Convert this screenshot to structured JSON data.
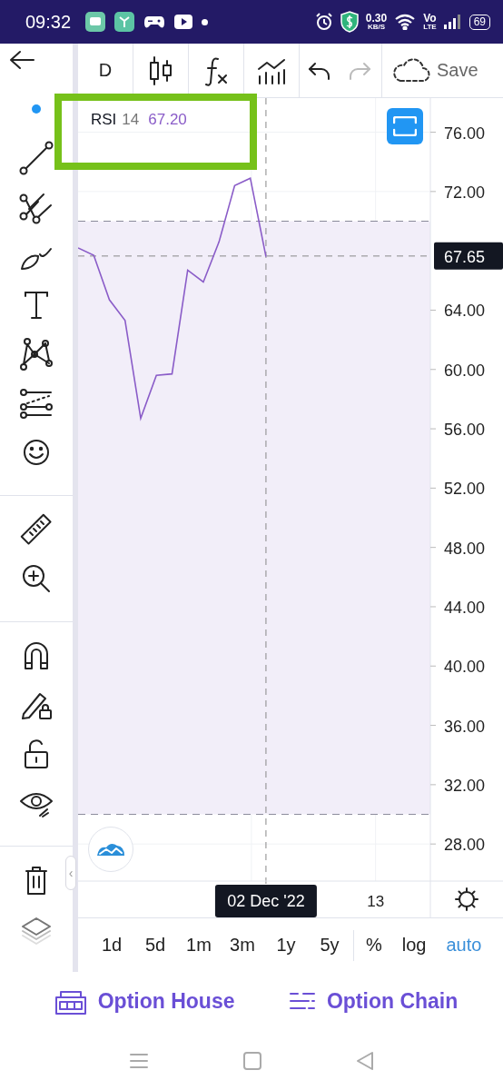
{
  "status_bar": {
    "time": "09:32",
    "notifications": [
      {
        "kind": "chat"
      },
      {
        "kind": "app"
      },
      {
        "kind": "gamepad"
      },
      {
        "kind": "video"
      },
      {
        "kind": "dot"
      }
    ],
    "speed": "0.30",
    "speed_unit": "KB/S",
    "volte_top": "Vo",
    "volte_bottom": "LTE",
    "battery": "69"
  },
  "toolbar": {
    "interval": "D",
    "buttons": [
      {
        "kind": "candles",
        "disabled": false
      },
      {
        "kind": "function",
        "disabled": false
      },
      {
        "kind": "indicators",
        "disabled": false
      },
      {
        "kind": "undo",
        "disabled": false
      },
      {
        "kind": "redo",
        "disabled": true
      }
    ],
    "save": {
      "label": "Save"
    }
  },
  "tool_groups": [
    {
      "tools": [
        {
          "kind": "dot"
        },
        {
          "kind": "trend-line"
        },
        {
          "kind": "pitchfork"
        },
        {
          "kind": "brush"
        },
        {
          "kind": "text"
        },
        {
          "kind": "pattern"
        },
        {
          "kind": "parallel"
        },
        {
          "kind": "emoji"
        }
      ]
    },
    {
      "tools": [
        {
          "kind": "ruler"
        },
        {
          "kind": "zoom"
        }
      ]
    },
    {
      "tools": [
        {
          "kind": "magnet"
        },
        {
          "kind": "pencil-lock"
        },
        {
          "kind": "lock"
        },
        {
          "kind": "eye"
        }
      ]
    },
    {
      "tools": [
        {
          "kind": "trash"
        },
        {
          "kind": "layers"
        }
      ]
    }
  ],
  "collapse_handle": "‹",
  "legend": {
    "params": "14",
    "value": "67.20",
    "highlighted": true
  },
  "chart_data": {
    "type": "line",
    "series": [
      {
        "name": "RSI",
        "color": "#8a5cc8",
        "values": [
          68.2,
          67.7,
          64.7,
          63.3,
          56.7,
          59.6,
          59.7,
          66.7,
          65.9,
          68.6,
          72.4,
          72.9,
          67.6,
          null,
          null,
          null,
          null,
          null,
          null,
          null,
          null,
          null,
          null
        ]
      }
    ],
    "categories": [
      null,
      null,
      null,
      null,
      null,
      null,
      null,
      null,
      null,
      null,
      null,
      null,
      "02 Dec '22",
      null,
      null,
      null,
      null,
      null,
      null,
      "13",
      null,
      null,
      null
    ],
    "ylim": [
      25.5,
      78.3
    ],
    "yticks": [
      {
        "value": 76,
        "label": "76.00"
      },
      {
        "value": 72,
        "label": "72.00"
      },
      {
        "value": 64,
        "label": "64.00"
      },
      {
        "value": 60,
        "label": "60.00"
      },
      {
        "value": 56,
        "label": "56.00"
      },
      {
        "value": 52,
        "label": "52.00"
      },
      {
        "value": 48,
        "label": "48.00"
      },
      {
        "value": 44,
        "label": "44.00"
      },
      {
        "value": 40,
        "label": "40.00"
      },
      {
        "value": 36,
        "label": "36.00"
      },
      {
        "value": 32,
        "label": "32.00"
      },
      {
        "value": 28,
        "label": "28.00"
      }
    ],
    "bands": [
      {
        "axis": "y",
        "from": 30,
        "to": 70
      }
    ],
    "ref_lines": [
      {
        "axis": "y",
        "value": 70
      },
      {
        "axis": "y",
        "value": 30
      },
      {
        "axis": "y",
        "value": 67.65,
        "label": "67.65"
      },
      {
        "axis": "x",
        "value": "02 Dec '22"
      }
    ],
    "grid": true
  },
  "ranges": [
    {
      "label": "1d",
      "selected": false
    },
    {
      "label": "5d",
      "selected": false
    },
    {
      "label": "1m",
      "selected": false
    },
    {
      "label": "3m",
      "selected": false
    },
    {
      "label": "1y",
      "selected": false
    },
    {
      "label": "5y",
      "selected": false
    }
  ],
  "scales": [
    {
      "label": "%",
      "selected": false
    },
    {
      "label": "log",
      "selected": false
    },
    {
      "label": "auto",
      "selected": true
    }
  ],
  "actions": [
    {
      "kind": "house",
      "label": "Option House"
    },
    {
      "kind": "chain",
      "label": "Option Chain"
    }
  ],
  "nav": [
    {
      "kind": "menu"
    },
    {
      "kind": "home"
    },
    {
      "kind": "back"
    }
  ]
}
